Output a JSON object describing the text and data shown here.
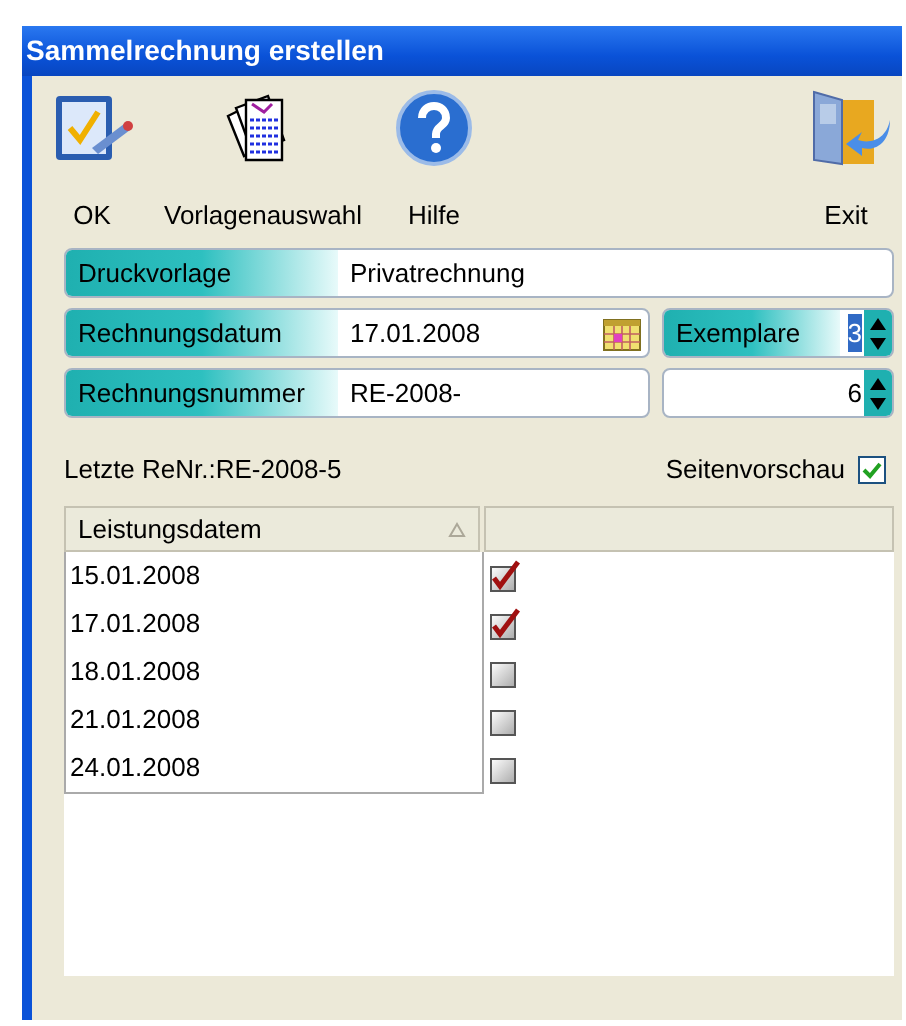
{
  "window": {
    "title": "Sammelrechnung erstellen"
  },
  "toolbar": [
    {
      "kind": "ok",
      "label": "OK"
    },
    {
      "kind": "templates",
      "label": "Vorlagenauswahl"
    },
    {
      "kind": "help",
      "label": "Hilfe"
    },
    {
      "kind": "exit",
      "label": "Exit"
    }
  ],
  "print_template": {
    "label": "Druckvorlage",
    "value": "Privatrechnung"
  },
  "invoice_date": {
    "label": "Rechnungsdatum",
    "value": "17.01.2008"
  },
  "copies": {
    "label": "Exemplare",
    "value": "3",
    "selected": true
  },
  "invoice_number": {
    "label": "Rechnungsnummer",
    "value": "RE-2008-"
  },
  "invoice_counter": {
    "value": "6",
    "selected": false
  },
  "last_invoice": "Letzte ReNr.:RE-2008-5",
  "page_preview": {
    "label": "Seitenvorschau",
    "checked": true
  },
  "table": {
    "columns": [
      "Leistungsdatem"
    ],
    "rows": [
      {
        "date": "15.01.2008",
        "checked": true
      },
      {
        "date": "17.01.2008",
        "checked": true
      },
      {
        "date": "18.01.2008",
        "checked": false
      },
      {
        "date": "21.01.2008",
        "checked": false
      },
      {
        "date": "24.01.2008",
        "checked": false
      }
    ]
  }
}
